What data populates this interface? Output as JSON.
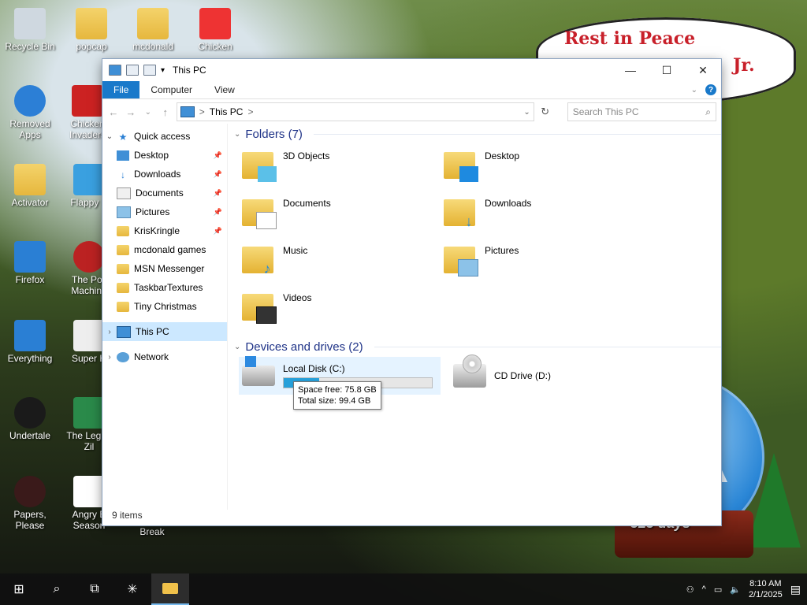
{
  "desktop": {
    "icons": [
      {
        "label": "Recycle Bin"
      },
      {
        "label": "popcap"
      },
      {
        "label": "mcdonald"
      },
      {
        "label": "Chicken"
      },
      {
        "label": "Removed Apps"
      },
      {
        "label": "Chicken Invaders"
      },
      {
        "label": "Activator"
      },
      {
        "label": "Flappy P"
      },
      {
        "label": "Firefox"
      },
      {
        "label": "The Poli Machine"
      },
      {
        "label": "Everything"
      },
      {
        "label": "Super H"
      },
      {
        "label": "Undertale"
      },
      {
        "label": "The Leg of Zil"
      },
      {
        "label": "Papers, Please"
      },
      {
        "label": "Angry B Season"
      },
      {
        "label": "Break"
      }
    ],
    "banner": {
      "line1": "Rest in Peace",
      "line2": "Jr."
    },
    "countdown": "323 days"
  },
  "window": {
    "title": "This PC",
    "ribbon": {
      "file": "File",
      "computer": "Computer",
      "view": "View"
    },
    "address": {
      "path": "This PC",
      "separator": ">"
    },
    "search": {
      "placeholder": "Search This PC"
    },
    "nav": {
      "quick_access": "Quick access",
      "items": [
        {
          "label": "Desktop",
          "pinned": true
        },
        {
          "label": "Downloads",
          "pinned": true
        },
        {
          "label": "Documents",
          "pinned": true
        },
        {
          "label": "Pictures",
          "pinned": true
        },
        {
          "label": "KrisKringle",
          "pinned": true
        },
        {
          "label": "mcdonald games",
          "pinned": false
        },
        {
          "label": "MSN Messenger",
          "pinned": false
        },
        {
          "label": "TaskbarTextures",
          "pinned": false
        },
        {
          "label": "Tiny Christmas",
          "pinned": false
        }
      ],
      "this_pc": "This PC",
      "network": "Network"
    },
    "folders": {
      "header": "Folders (7)",
      "items": [
        {
          "label": "3D Objects"
        },
        {
          "label": "Desktop"
        },
        {
          "label": "Documents"
        },
        {
          "label": "Downloads"
        },
        {
          "label": "Music"
        },
        {
          "label": "Pictures"
        },
        {
          "label": "Videos"
        }
      ]
    },
    "drives": {
      "header": "Devices and drives (2)",
      "items": [
        {
          "label": "Local Disk (C:)",
          "used_fraction": 0.24
        },
        {
          "label": "CD Drive (D:)"
        }
      ]
    },
    "tooltip": {
      "line1": "Space free: 75.8 GB",
      "line2": "Total size: 99.4 GB"
    },
    "status": "9 items"
  },
  "taskbar": {
    "time": "8:10 AM",
    "date": "2/1/2025"
  }
}
